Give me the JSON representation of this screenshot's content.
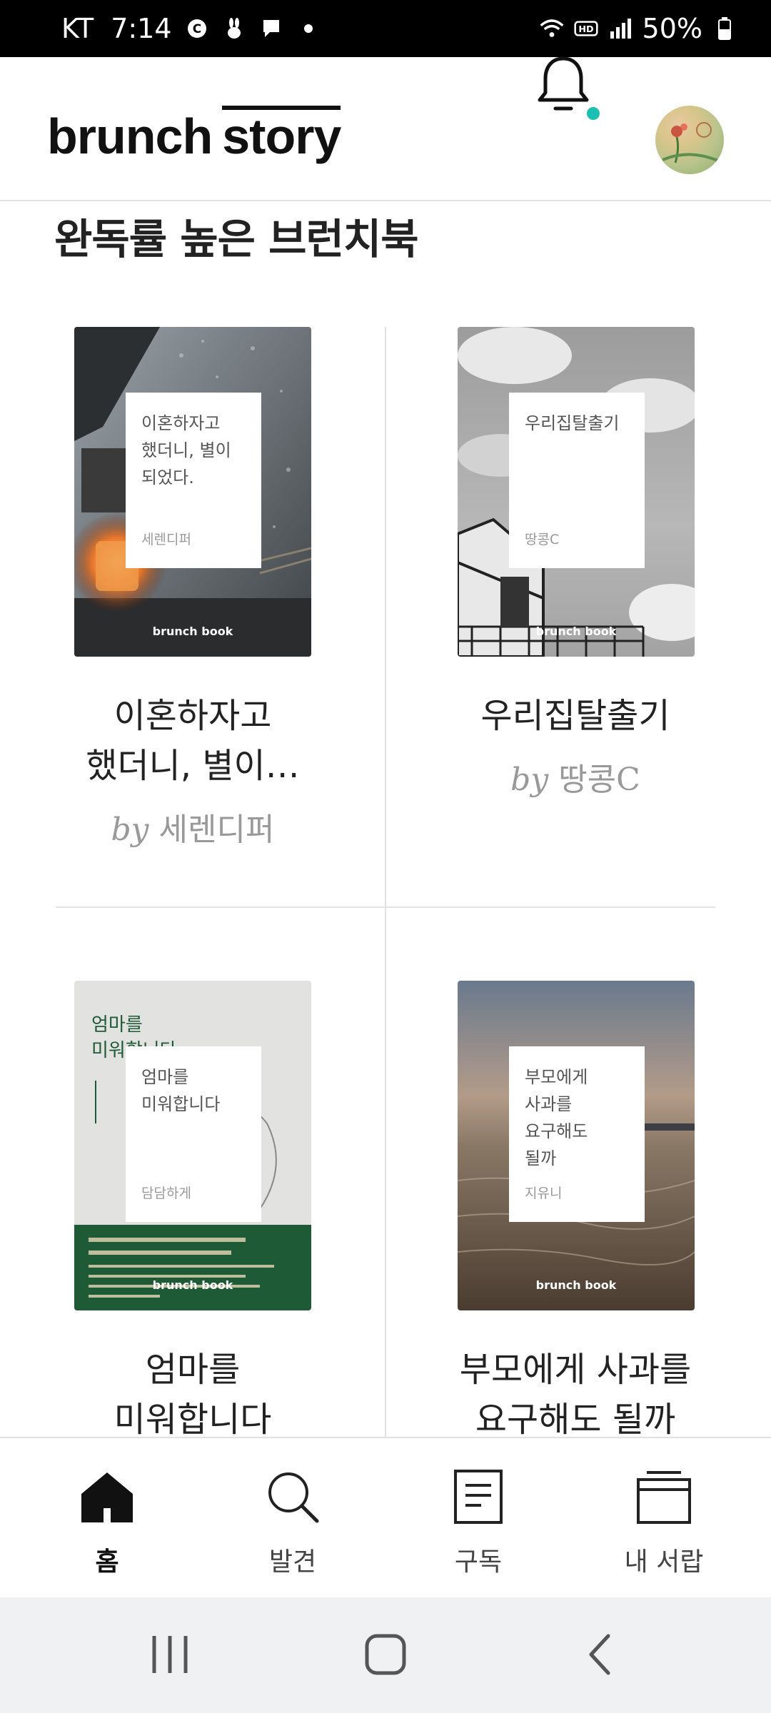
{
  "status_bar": {
    "carrier": "KT",
    "time": "7:14",
    "battery": "50%",
    "icons": [
      "c-circle-icon",
      "rabbit-icon",
      "message-icon",
      "dot-icon",
      "wifi-icon",
      "hd-icon",
      "signal-icon",
      "battery-icon"
    ]
  },
  "header": {
    "logo_part1": "brunch",
    "logo_part2": "story",
    "notification_dot_color": "#1cc0b0"
  },
  "section": {
    "title": "완독률 높은 브런치북"
  },
  "books": [
    {
      "cover_title": "이혼하자고\n했더니, 별이\n되었다.",
      "cover_author": "세렌디퍼",
      "cover_brand": "brunch book",
      "title": "이혼하자고\n했더니, 별이…",
      "by": "by",
      "author": "세렌디퍼"
    },
    {
      "cover_title": "우리집탈출기",
      "cover_author": "땅콩C",
      "cover_brand": "brunch book",
      "title": "우리집탈출기",
      "by": "by",
      "author": "땅콩C"
    },
    {
      "cover_title": "엄마를\n미워합니다",
      "cover_author": "담담하게",
      "cover_brand": "brunch book",
      "cover_bg_title": "엄마를\n미워합니다",
      "title": "엄마를\n미워합니다"
    },
    {
      "cover_title": "부모에게\n사과를\n요구해도\n될까",
      "cover_author": "지유니",
      "cover_brand": "brunch book",
      "title": "부모에게 사과를\n요구해도 될까"
    }
  ],
  "bottom_nav": {
    "items": [
      {
        "label": "홈",
        "icon": "home-icon",
        "active": true
      },
      {
        "label": "발견",
        "icon": "search-icon",
        "active": false
      },
      {
        "label": "구독",
        "icon": "document-icon",
        "active": false
      },
      {
        "label": "내 서랍",
        "icon": "drawer-icon",
        "active": false
      }
    ]
  },
  "system_nav": [
    "recents-icon",
    "home-button-icon",
    "back-icon"
  ]
}
